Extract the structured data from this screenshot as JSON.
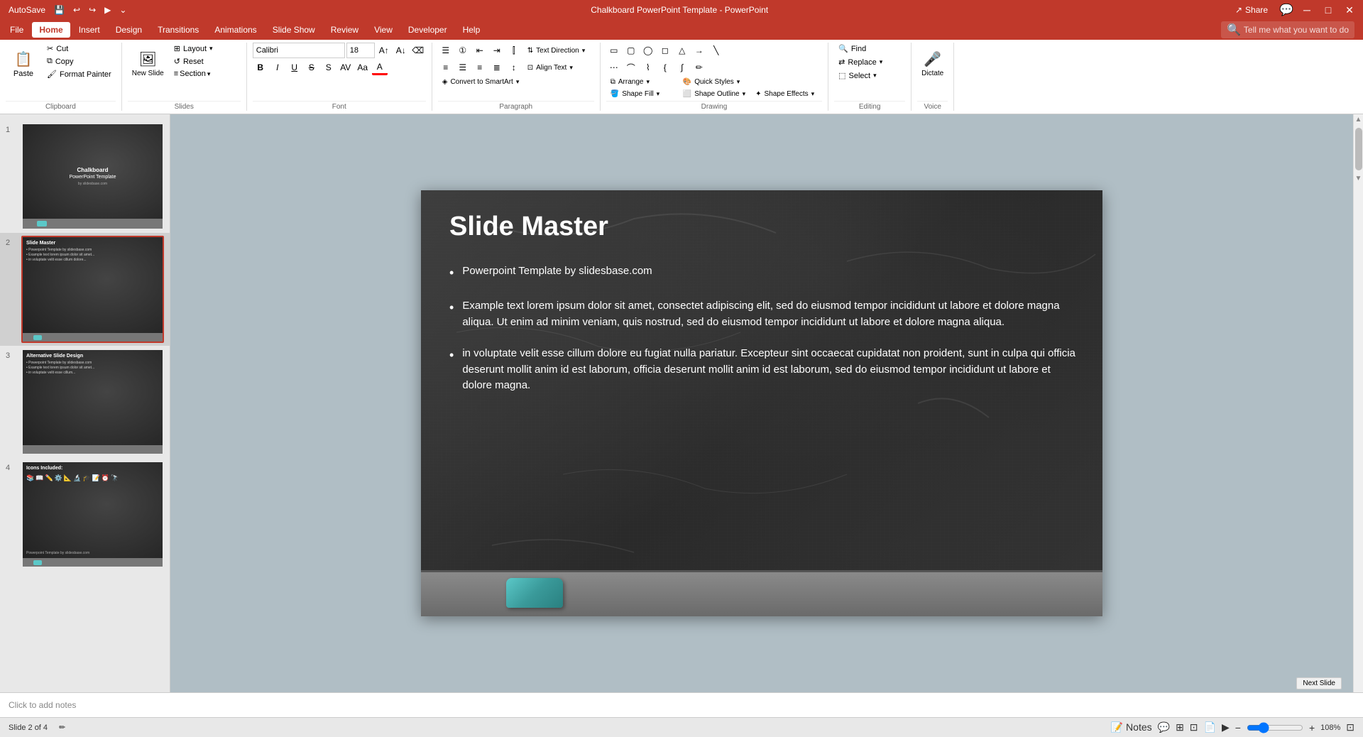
{
  "app": {
    "title": "Chalkboard PowerPoint Template - PowerPoint",
    "autosave_label": "AutoSave",
    "file_name": "Chalkboard PowerPoint Template"
  },
  "title_bar": {
    "autosave": "AutoSave",
    "file_name": "Chalkboard PowerPoint Template - PowerPoint",
    "share_label": "Share",
    "window_controls": [
      "─",
      "□",
      "✕"
    ]
  },
  "menu": {
    "items": [
      "File",
      "Home",
      "Insert",
      "Design",
      "Transitions",
      "Animations",
      "Slide Show",
      "Review",
      "View",
      "Developer",
      "Help"
    ],
    "active": "Home",
    "search_placeholder": "Tell me what you want to do"
  },
  "ribbon": {
    "clipboard_group": {
      "label": "Clipboard",
      "paste_label": "Paste",
      "cut_label": "Cut",
      "copy_label": "Copy",
      "format_painter_label": "Format Painter"
    },
    "slides_group": {
      "label": "Slides",
      "new_slide_label": "New Slide",
      "layout_label": "Layout",
      "reset_label": "Reset",
      "section_label": "Section"
    },
    "font_group": {
      "label": "Font",
      "font_name": "Calibri",
      "font_size": "18",
      "bold": "B",
      "italic": "I",
      "underline": "U",
      "strikethrough": "S",
      "shadow": "S",
      "font_color": "A"
    },
    "paragraph_group": {
      "label": "Paragraph",
      "text_direction_label": "Text Direction",
      "align_text_label": "Align Text",
      "convert_smartart_label": "Convert to SmartArt"
    },
    "drawing_group": {
      "label": "Drawing",
      "arrange_label": "Arrange",
      "quick_styles_label": "Quick Styles",
      "shape_fill_label": "Shape Fill",
      "shape_outline_label": "Shape Outline",
      "shape_effects_label": "Shape Effects"
    },
    "editing_group": {
      "label": "Editing",
      "find_label": "Find",
      "replace_label": "Replace",
      "select_label": "Select"
    },
    "voice_group": {
      "label": "Voice",
      "dictate_label": "Dictate"
    }
  },
  "slides": [
    {
      "number": "1",
      "title": "Chalkboard PowerPoint Template",
      "subtitle": "by slidesbase.com",
      "type": "title"
    },
    {
      "number": "2",
      "title": "Slide Master",
      "type": "content",
      "active": true
    },
    {
      "number": "3",
      "title": "Alternative Slide Design",
      "type": "content"
    },
    {
      "number": "4",
      "title": "Icons Included:",
      "type": "icons"
    }
  ],
  "main_slide": {
    "title": "Slide Master",
    "bullets": [
      "Powerpoint Template by slidesbase.com",
      "Example text lorem ipsum dolor sit amet, consectet adipiscing elit, sed do eiusmod tempor incididunt ut labore et dolore magna aliqua. Ut enim ad minim veniam, quis nostrud, sed do eiusmod tempor incididunt ut labore et dolore magna aliqua.",
      "in voluptate velit esse cillum dolore eu fugiat nulla pariatur. Excepteur sint occaecat cupidatat non proident, sunt in culpa qui officia deserunt mollit anim id est laborum, officia deserunt mollit anim id est laborum, sed do eiusmod tempor incididunt ut labore et dolore magna."
    ]
  },
  "status_bar": {
    "slide_info": "Slide 2 of 4",
    "notes_label": "Notes",
    "comments_label": "Comments",
    "zoom_level": "108%",
    "next_slide": "Next Slide",
    "click_to_add_notes": "Click to add notes"
  }
}
